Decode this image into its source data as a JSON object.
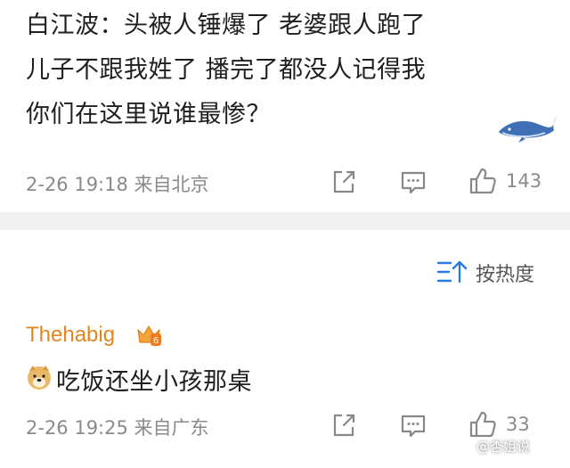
{
  "comment1": {
    "lines": [
      "白江波：头被人锤爆了 老婆跟人跑了",
      "儿子不跟我姓了 播完了都没人记得我",
      "你们在这里说谁最惨？"
    ],
    "time_location": "2-26 19:18 来自北京",
    "like_count": "143"
  },
  "sort": {
    "label": "按热度"
  },
  "comment2": {
    "username": "Thehabig",
    "text": "吃饭还坐小孩那桌",
    "time_location": "2-26 19:25 来自广东",
    "like_count": "33"
  },
  "watermark": "@杏姐说",
  "colors": {
    "username": "#e2861d",
    "meta": "#8a8a8a",
    "separator": "#f1f1f1"
  },
  "icons": [
    "whale-sticker-icon",
    "share-icon",
    "comment-icon",
    "like-icon",
    "sort-icon",
    "vip-crown-icon",
    "doge-emoji-icon"
  ]
}
